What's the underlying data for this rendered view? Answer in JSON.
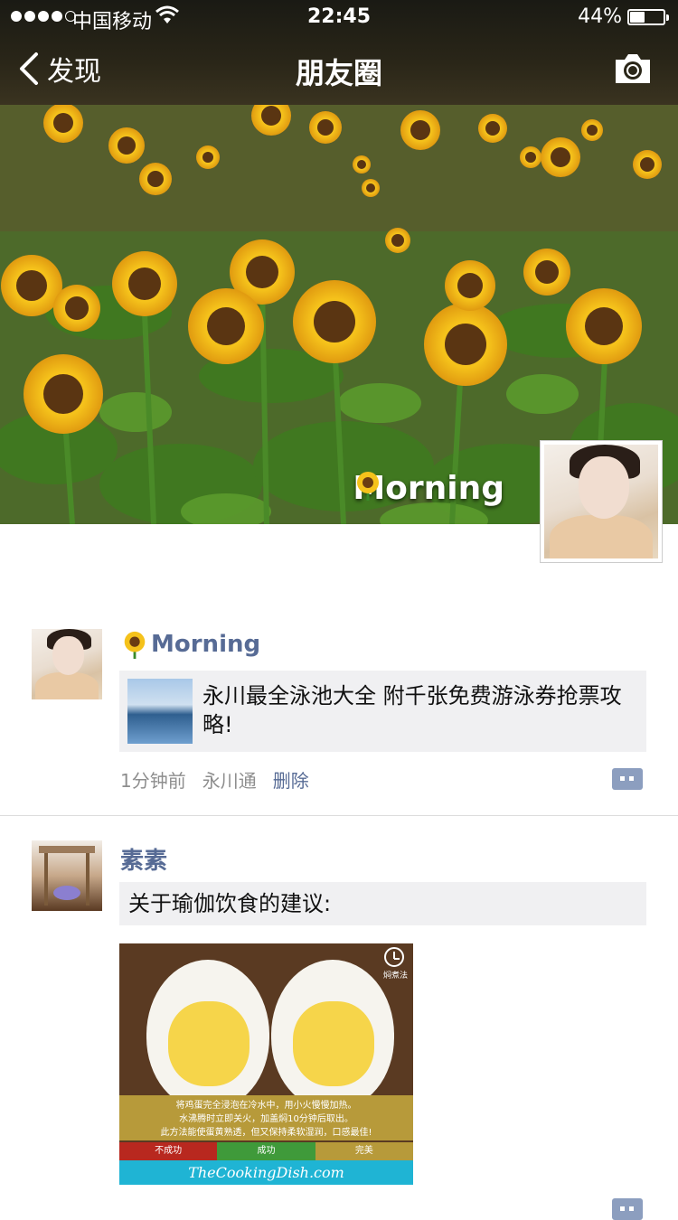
{
  "status_bar": {
    "carrier": "中国移动",
    "time": "22:45",
    "battery_pct": "44%",
    "battery_level": 0.44,
    "signal_bars": 4,
    "signal_max": 5
  },
  "nav": {
    "back_label": "发现",
    "title": "朋友圈",
    "back_icon": "chevron-left-icon",
    "camera_icon": "camera-icon"
  },
  "cover": {
    "user_name": "Morning",
    "name_icon": "sunflower-icon"
  },
  "posts": [
    {
      "author": "Morning",
      "author_icon": "sunflower-icon",
      "link_title": "永川最全泳池大全 附千张免费游泳券抢票攻略!",
      "time": "1分钟前",
      "source": "永川通",
      "delete_label": "删除"
    },
    {
      "author": "素素",
      "text": "关于瑜伽饮食的建议:",
      "image": {
        "clock_label": "焖煮法",
        "caption_lines": [
          "将鸡蛋完全浸泡在冷水中，用小火慢慢加热。",
          "水沸腾时立即关火，加盖焖10分钟后取出。",
          "此方法能使蛋黄熟透，但又保持柔软湿润，口感最佳!"
        ],
        "tags": [
          "不成功",
          "成功",
          "完美"
        ],
        "brand": "TheCookingDish.com"
      }
    }
  ],
  "colors": {
    "link_blue": "#576b95",
    "meta_gray": "#8e8e8e",
    "bubble_bg": "#f0f0f2",
    "header_bg": "#2a2618"
  }
}
